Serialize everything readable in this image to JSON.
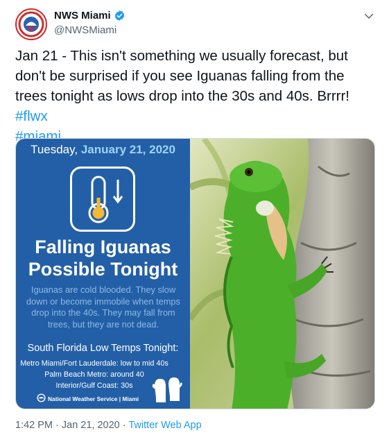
{
  "tweet": {
    "author_name": "NWS Miami",
    "author_handle": "@NWSMiami",
    "text_main": "Jan 21 - This isn't something we usually forecast, but don't be surprised if you see Iguanas falling from the trees tonight as lows drop into the 30s and 40s. Brrrr! ",
    "hashtags": [
      "#flwx",
      "#miami"
    ],
    "timestamp": "1:42 PM · Jan 21, 2020 · ",
    "source_app": "Twitter Web App",
    "avatar_text": "NATIONAL WEATHER SERVICE"
  },
  "graphic": {
    "date_prefix": "Tuesday, ",
    "date_value": "January 21, 2020",
    "headline_line1": "Falling Iguanas",
    "headline_line2": "Possible Tonight",
    "description": "Iguanas are cold blooded. They slow down or become immobile when temps drop into the 40s. They may fall from trees, but they are not dead.",
    "lows_title": "South Florida Low Temps Tonight:",
    "lows": [
      "Metro Miami/Fort Lauderdale: low to mid 40s",
      "Palm Beach Metro: around 40",
      "Interior/Gulf Coast: 30s"
    ],
    "footer": "National Weather Service | Miami"
  },
  "colors": {
    "panel_bg": "#235fa6",
    "accent_blue": "#1d9bf0",
    "date_accent": "#9fd3f8",
    "iguana_green": "#4caf2a"
  },
  "icons": [
    "verified-badge-icon",
    "chevron-down-icon",
    "thermometer-icon",
    "down-arrow-icon",
    "gloves-icon",
    "noaa-logo-icon"
  ]
}
